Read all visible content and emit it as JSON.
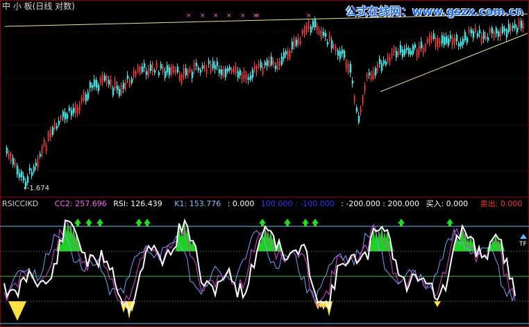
{
  "main_panel": {
    "title": "中 小 板(日线 对数)",
    "low_label": "←1.674",
    "watermark": "公式在线网：www.gszx.com.cn",
    "colors": {
      "up": "#ff4040",
      "down": "#40e0e0",
      "trend": "#f0e68c",
      "grid": "#8b0000",
      "mark": "#ff66cc"
    }
  },
  "indicator_panel": {
    "name": "RSICCIKD",
    "cc2": "CC2: 257.696",
    "rsi": "RSI: 126.439",
    "k1": "K1: 153.776",
    "v1": ": 0.000",
    "v2": "100.000",
    "v3": ": -100.000",
    "v4": ": -200.000",
    "v5": ": 200.000",
    "buy": "买入: 0.000",
    "sell": "卖出: 0.000",
    "right_tag": "TF",
    "colors": {
      "name": "#d0d0d0",
      "cc2": "#ff60ff",
      "rsi": "#ffffff",
      "k1": "#80c0ff",
      "v1": "#ffffff",
      "v2": "#3030ff",
      "v3": "#3030ff",
      "v4": "#ffffff",
      "v5": "#ffffff",
      "buy": "#ffffff",
      "sell": "#ff3030"
    }
  }
}
